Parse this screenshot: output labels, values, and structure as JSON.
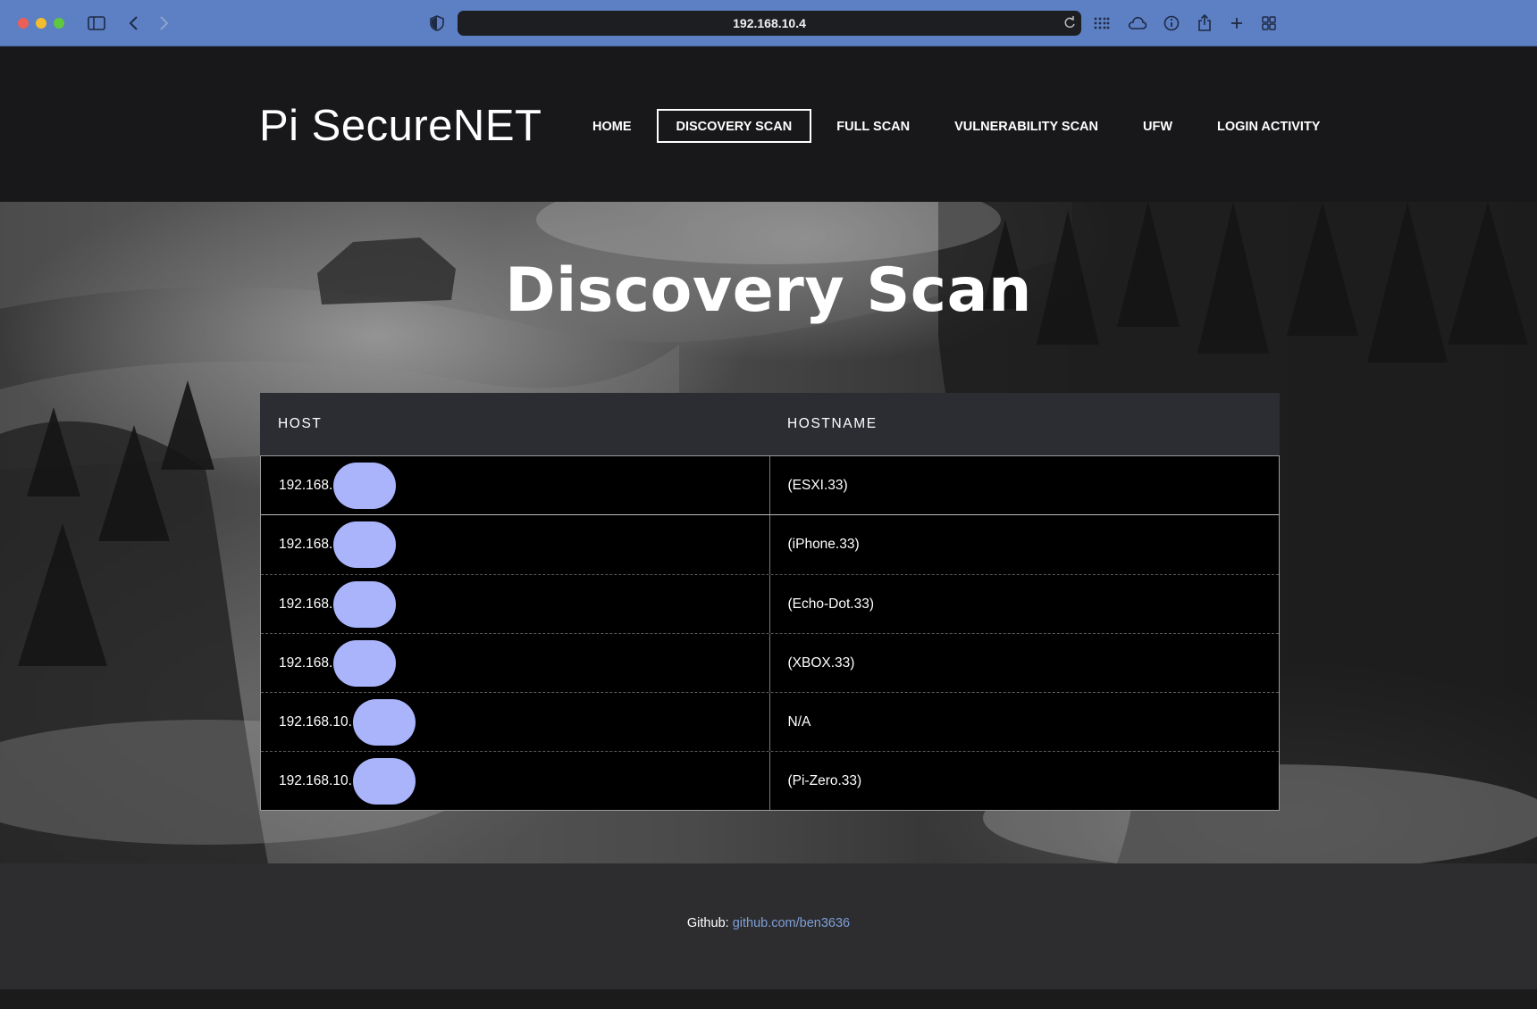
{
  "browser": {
    "url": "192.168.10.4"
  },
  "site": {
    "logo": "Pi SecureNET",
    "nav": [
      {
        "label": "HOME",
        "active": false
      },
      {
        "label": "DISCOVERY SCAN",
        "active": true
      },
      {
        "label": "FULL SCAN",
        "active": false
      },
      {
        "label": "VULNERABILITY SCAN",
        "active": false
      },
      {
        "label": "UFW",
        "active": false
      },
      {
        "label": "LOGIN ACTIVITY",
        "active": false
      }
    ]
  },
  "hero": {
    "title": "Discovery Scan"
  },
  "table": {
    "headers": [
      "HOST",
      "HOSTNAME"
    ],
    "rows": [
      {
        "host": "192.168.",
        "hostname": "(ESXI.33)"
      },
      {
        "host": "192.168.",
        "hostname": "(iPhone.33)"
      },
      {
        "host": "192.168.",
        "hostname": "(Echo-Dot.33)"
      },
      {
        "host": "192.168.",
        "hostname": "(XBOX.33)"
      },
      {
        "host": "192.168.10.",
        "hostname": "N/A"
      },
      {
        "host": "192.168.10.",
        "hostname": "(Pi-Zero.33)"
      }
    ],
    "redaction_color": "#aab4fb"
  },
  "footer": {
    "label": "Github:",
    "link_text": "github.com/ben3636",
    "link_color": "#7e9fd9"
  }
}
